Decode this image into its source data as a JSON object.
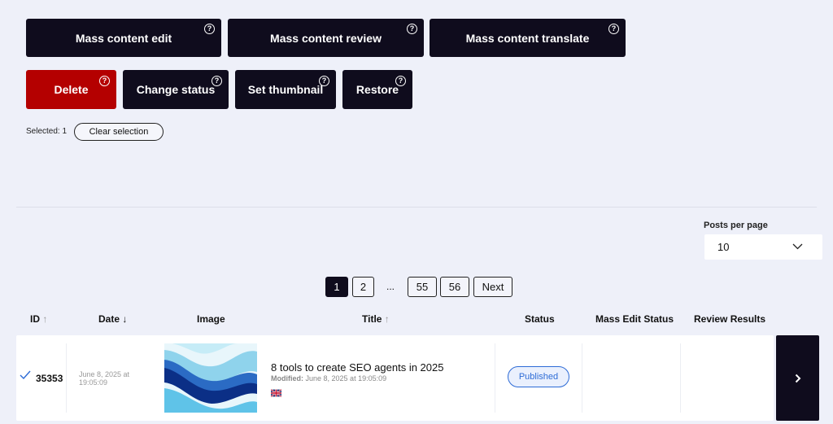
{
  "actions_top": {
    "mass_edit": "Mass content edit",
    "mass_review": "Mass content review",
    "mass_translate": "Mass content translate"
  },
  "actions_bulk": {
    "delete": "Delete",
    "change_status": "Change status",
    "set_thumbnail": "Set thumbnail",
    "restore": "Restore"
  },
  "help_glyph": "?",
  "selection": {
    "selected_text": "Selected: 1",
    "clear_label": "Clear selection"
  },
  "posts_per_page": {
    "label": "Posts per page",
    "value": "10"
  },
  "pagination": {
    "pages": [
      "1",
      "2",
      "55",
      "56"
    ],
    "ellipsis": "...",
    "next": "Next",
    "current": "1"
  },
  "table": {
    "headers": {
      "id": "ID",
      "date": "Date",
      "image": "Image",
      "title": "Title",
      "status": "Status",
      "mass_edit_status": "Mass Edit Status",
      "review_results": "Review Results"
    },
    "sort_up": "↑",
    "sort_down": "↓",
    "rows": [
      {
        "id": "35353",
        "date": "June 8, 2025 at 19:05:09",
        "title": "8 tools to create SEO agents in 2025",
        "modified_label": "Modified:",
        "modified_value": "June 8, 2025 at 19:05:09",
        "status": "Published",
        "language_flag": "uk-flag-icon"
      }
    ]
  },
  "colors": {
    "dark": "#0f0c1d",
    "danger": "#b40000",
    "accent": "#2d6bd6",
    "background": "#eef0f9"
  }
}
